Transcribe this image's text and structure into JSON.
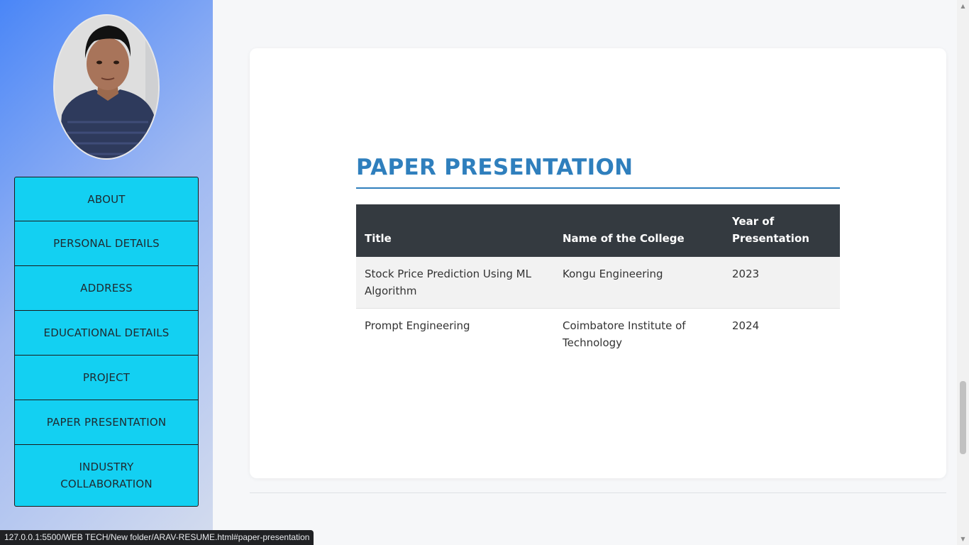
{
  "sidebar": {
    "nav_items": [
      "ABOUT",
      "PERSONAL DETAILS",
      "ADDRESS",
      "EDUCATIONAL DETAILS",
      "PROJECT",
      "PAPER PRESENTATION",
      "INDUSTRY COLLABORATION"
    ]
  },
  "section": {
    "heading": "PAPER PRESENTATION",
    "table": {
      "headers": [
        "Title",
        "Name of the College",
        "Year of Presentation"
      ],
      "rows": [
        [
          "Stock Price Prediction Using ML Algorithm",
          "Kongu Engineering",
          "2023"
        ],
        [
          "Prompt Engineering",
          "Coimbatore Institute of Technology",
          "2024"
        ]
      ]
    }
  },
  "status_bar": {
    "url": "127.0.0.1:5500/WEB TECH/New folder/ARAV-RESUME.html#paper-presentation"
  },
  "colors": {
    "nav_bg": "#13d0f2",
    "heading": "#2f7fbd",
    "table_header_bg": "#343a40"
  }
}
